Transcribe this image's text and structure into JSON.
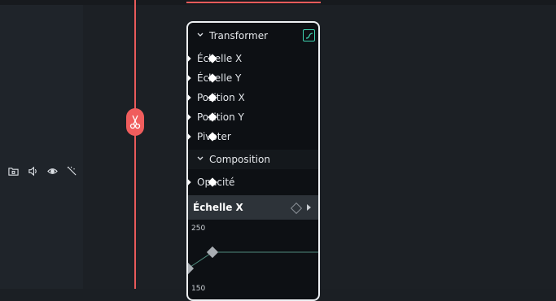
{
  "track_header": {
    "icons": [
      "folder-lock-icon",
      "speaker-icon",
      "eye-icon",
      "magic-wand-icon"
    ]
  },
  "keyframe_panel": {
    "transform_section": {
      "title": "Transformer",
      "properties": [
        "Échelle X",
        "Échelle Y",
        "Position X",
        "Position Y",
        "Pivoter"
      ]
    },
    "composition_section": {
      "title": "Composition",
      "properties": [
        "Opacité"
      ]
    },
    "selected_property": "Échelle X",
    "graph": {
      "y_top_label": "250",
      "y_bottom_label": "150"
    }
  },
  "colors": {
    "accent_red": "#e85a5a",
    "curve_icon_green": "#3fd3b1",
    "panel_border": "#eef1f4"
  }
}
